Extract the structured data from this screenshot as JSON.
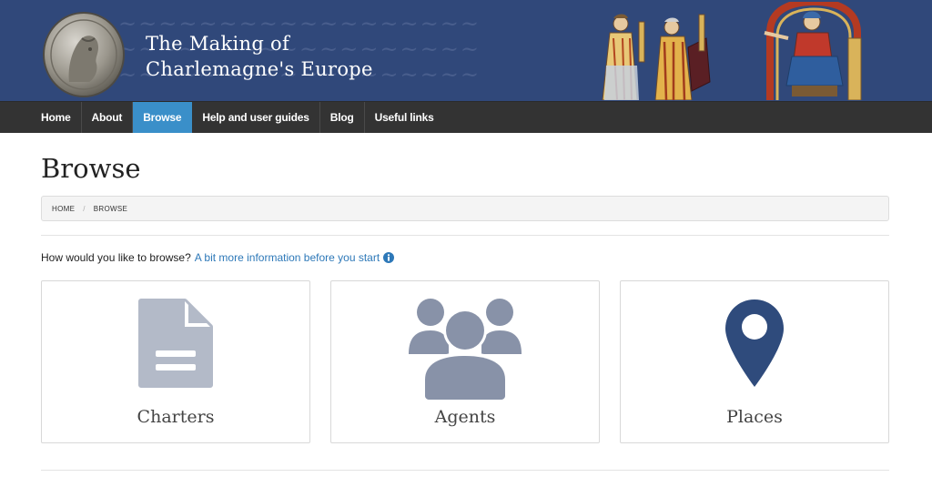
{
  "site": {
    "title_line1": "The Making of",
    "title_line2": "Charlemagne's Europe",
    "logo_icon": "coin-icon",
    "banner_images": [
      "manuscript-figures-left",
      "manuscript-figure-right"
    ]
  },
  "nav": {
    "items": [
      {
        "label": "Home",
        "active": false
      },
      {
        "label": "About",
        "active": false
      },
      {
        "label": "Browse",
        "active": true
      },
      {
        "label": "Help and user guides",
        "active": false
      },
      {
        "label": "Blog",
        "active": false
      },
      {
        "label": "Useful links",
        "active": false
      }
    ]
  },
  "page": {
    "title": "Browse"
  },
  "breadcrumb": {
    "items": [
      "HOME",
      "BROWSE"
    ],
    "separator": "/"
  },
  "intro": {
    "question": "How would you like to browse?",
    "link_text": "A bit more information before you start",
    "icon": "info-circle-icon"
  },
  "cards": [
    {
      "label": "Charters",
      "icon": "document-icon"
    },
    {
      "label": "Agents",
      "icon": "users-icon"
    },
    {
      "label": "Places",
      "icon": "map-marker-icon"
    }
  ],
  "colors": {
    "banner": "#30487a",
    "navbar": "#333333",
    "nav_active": "#3a8fc9",
    "link": "#2d78b8",
    "icon_light": "#b3bac8",
    "icon_mid": "#8892a8",
    "icon_dark": "#2f4b7c"
  }
}
